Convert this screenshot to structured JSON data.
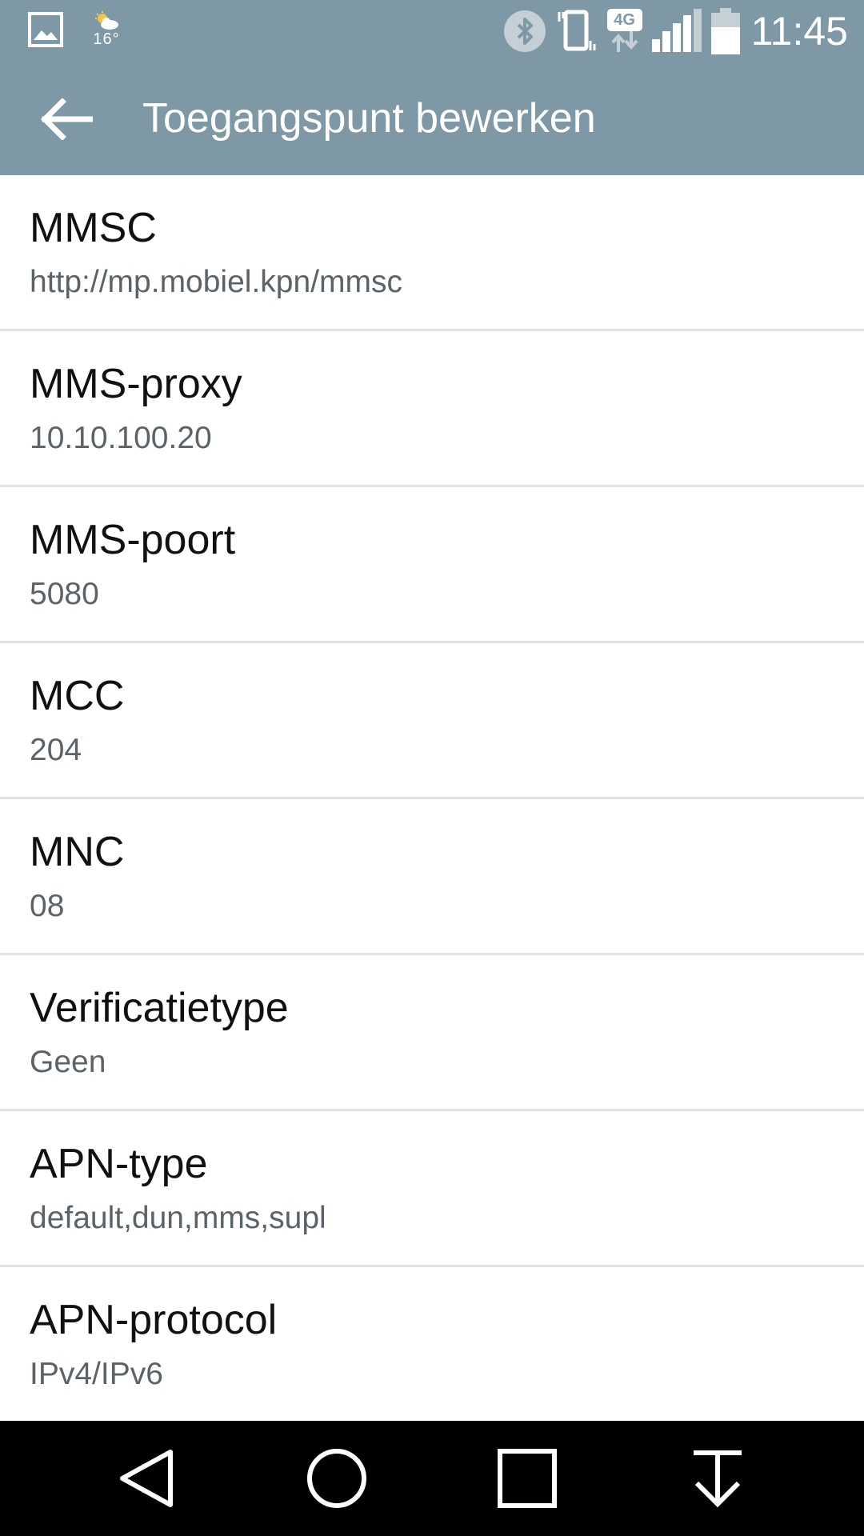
{
  "status_bar": {
    "temperature": "16°",
    "time": "11:45",
    "network_type": "4G",
    "icons": [
      "gallery-icon",
      "weather-icon",
      "bluetooth-icon",
      "vibrate-icon",
      "data-arrows-icon",
      "signal-icon",
      "battery-icon"
    ]
  },
  "app_bar": {
    "title": "Toegangspunt bewerken",
    "back_icon": "arrow-left-icon"
  },
  "settings": [
    {
      "title": "MMSC",
      "value": "http://mp.mobiel.kpn/mmsc"
    },
    {
      "title": "MMS-proxy",
      "value": "10.10.100.20"
    },
    {
      "title": "MMS-poort",
      "value": "5080"
    },
    {
      "title": "MCC",
      "value": "204"
    },
    {
      "title": "MNC",
      "value": "08"
    },
    {
      "title": "Verificatietype",
      "value": "Geen"
    },
    {
      "title": "APN-type",
      "value": "default,dun,mms,supl"
    },
    {
      "title": "APN-protocol",
      "value": "IPv4/IPv6"
    }
  ],
  "nav_bar": {
    "icons": [
      "back-triangle-icon",
      "home-circle-icon",
      "recents-square-icon",
      "download-arrow-icon"
    ]
  },
  "colors": {
    "app_bar": "#7e98a6",
    "divider": "#e1e1e1",
    "title_text": "#111111",
    "value_text": "#5b6368",
    "nav_bar": "#000000"
  }
}
